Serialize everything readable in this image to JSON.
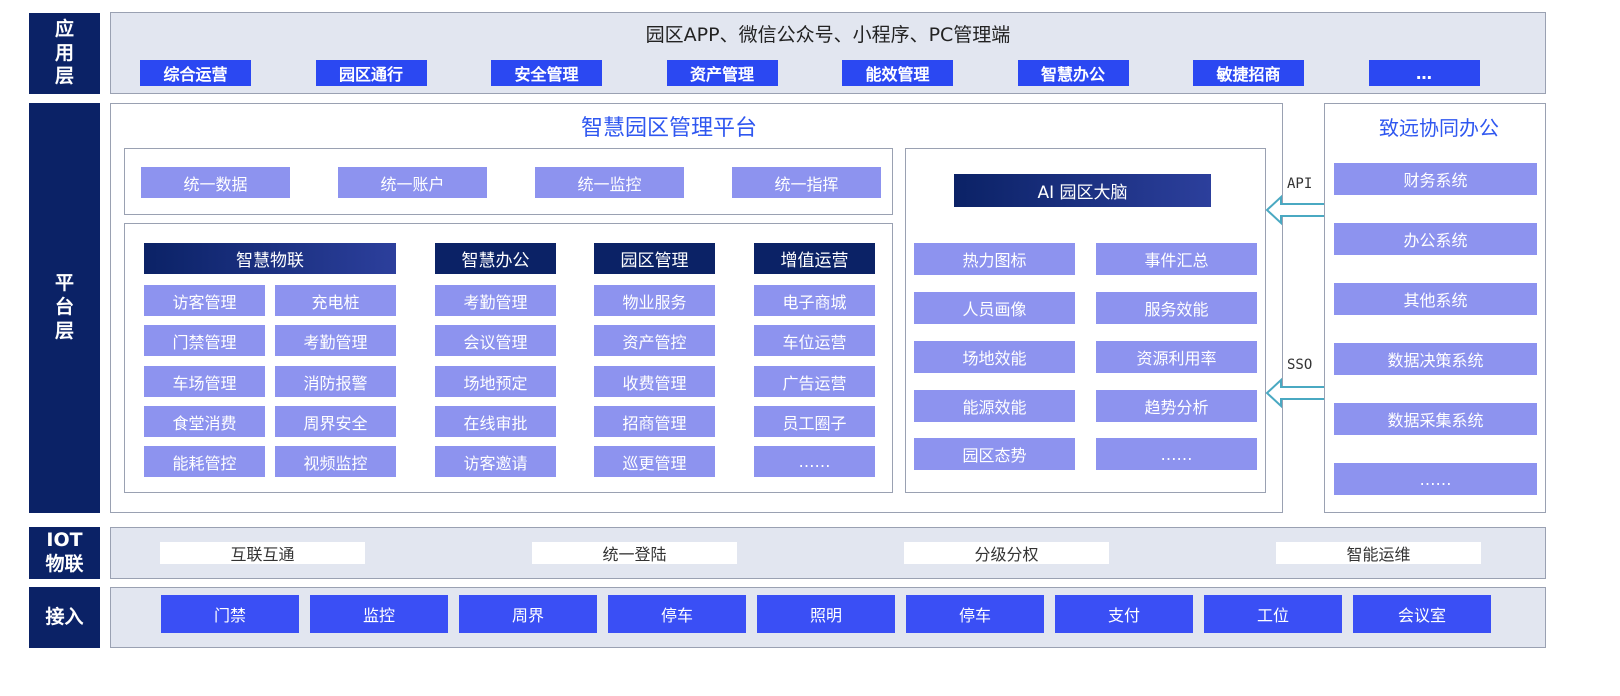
{
  "layers": {
    "app": "应用层",
    "platform": "平台层",
    "iot": "IOT物联",
    "access": "接入"
  },
  "app_layer": {
    "title": "园区APP、微信公众号、小程序、PC管理端",
    "buttons": [
      "综合运营",
      "园区通行",
      "安全管理",
      "资产管理",
      "能效管理",
      "智慧办公",
      "敏捷招商",
      "…"
    ]
  },
  "platform": {
    "title": "智慧园区管理平台",
    "unified": [
      "统一数据",
      "统一账户",
      "统一监控",
      "统一指挥"
    ],
    "columns": [
      {
        "header": "智慧物联",
        "items": [
          "访客管理",
          "充电桩",
          "门禁管理",
          "考勤管理",
          "车场管理",
          "消防报警",
          "食堂消费",
          "周界安全",
          "能耗管控",
          "视频监控"
        ]
      },
      {
        "header": "智慧办公",
        "items": [
          "考勤管理",
          "会议管理",
          "场地预定",
          "在线审批",
          "访客邀请"
        ]
      },
      {
        "header": "园区管理",
        "items": [
          "物业服务",
          "资产管控",
          "收费管理",
          "招商管理",
          "巡更管理"
        ]
      },
      {
        "header": "增值运营",
        "items": [
          "电子商城",
          "车位运营",
          "广告运营",
          "员工圈子",
          "……"
        ]
      }
    ],
    "ai": {
      "header": "AI 园区大脑",
      "items": [
        "热力图标",
        "事件汇总",
        "人员画像",
        "服务效能",
        "场地效能",
        "资源利用率",
        "能源效能",
        "趋势分析",
        "园区态势",
        "……"
      ]
    }
  },
  "connectors": {
    "api": "API",
    "sso": "SSO"
  },
  "collab": {
    "title": "致远协同办公",
    "items": [
      "财务系统",
      "办公系统",
      "其他系统",
      "数据决策系统",
      "数据采集系统",
      "……"
    ]
  },
  "iot_layer": {
    "items": [
      "互联互通",
      "统一登陆",
      "分级分权",
      "智能运维"
    ]
  },
  "access_layer": {
    "items": [
      "门禁",
      "监控",
      "周界",
      "停车",
      "照明",
      "停车",
      "支付",
      "工位",
      "会议室"
    ]
  },
  "colors": {
    "navy": "#0b2266",
    "accent_blue": "#2b48f2",
    "tile_purple": "#8d93ef",
    "title_blue": "#2f57f0",
    "panel_gray": "#e2e6f0",
    "arrow_teal": "#4aa9c2"
  }
}
